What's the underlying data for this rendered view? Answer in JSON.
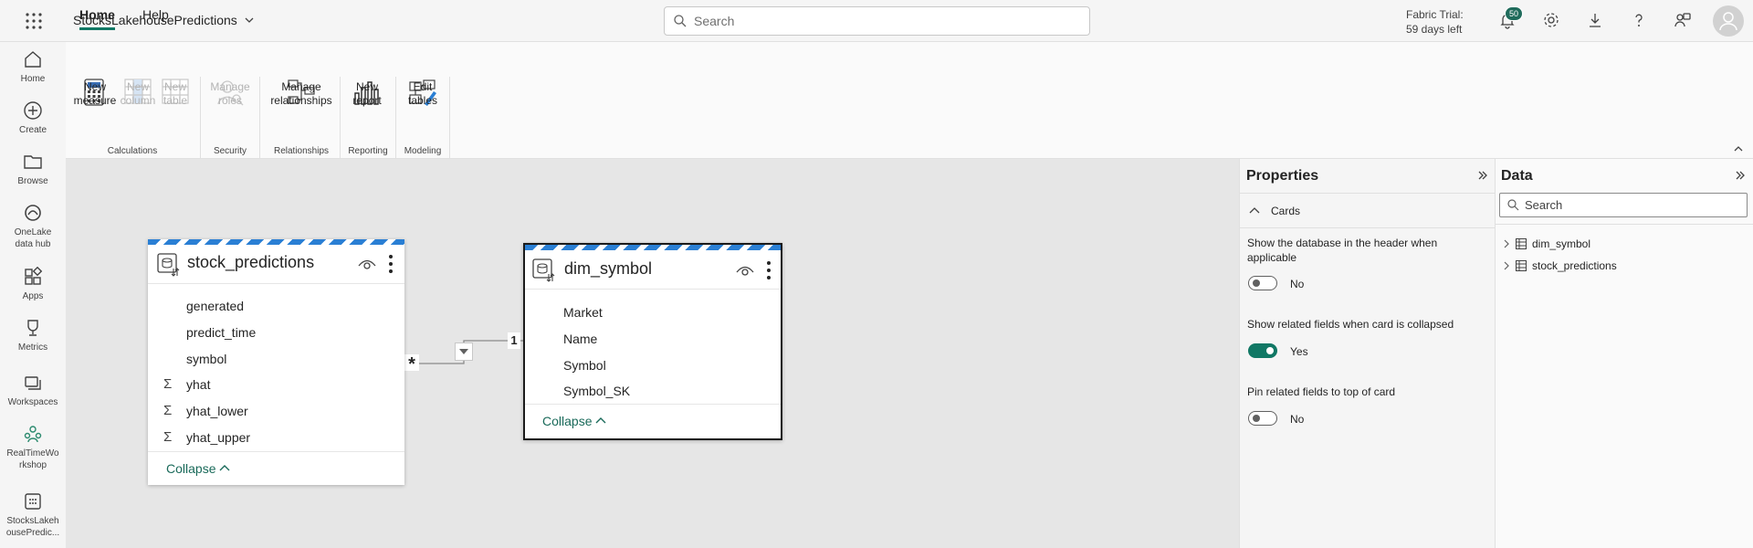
{
  "header": {
    "app_name": "StocksLakehousePredictions",
    "search_placeholder": "Search",
    "trial_line1": "Fabric Trial:",
    "trial_line2": "59 days left",
    "notifications_count": "50"
  },
  "rail": {
    "items": [
      {
        "label": "Home",
        "icon": "home-icon"
      },
      {
        "label": "Create",
        "icon": "create-icon"
      },
      {
        "label": "Browse",
        "icon": "browse-icon"
      },
      {
        "label_line1": "OneLake",
        "label_line2": "data hub",
        "icon": "onelake-icon"
      },
      {
        "label": "Apps",
        "icon": "apps-icon"
      },
      {
        "label": "Metrics",
        "icon": "metrics-icon"
      },
      {
        "label": "Workspaces",
        "icon": "workspaces-icon"
      },
      {
        "label_line1": "RealTimeWo",
        "label_line2": "rkshop",
        "icon": "workspace-icon"
      },
      {
        "label_line1": "StocksLakeh",
        "label_line2": "ousePredic...",
        "icon": "model-icon"
      }
    ]
  },
  "ribbon": {
    "tabs": [
      "Home",
      "Help"
    ],
    "buttons": {
      "new_measure": [
        "New",
        "measure"
      ],
      "new_column": [
        "New",
        "column"
      ],
      "new_table": [
        "New",
        "table"
      ],
      "manage_roles": [
        "Manage",
        "roles"
      ],
      "manage_relationships": [
        "Manage",
        "relationships"
      ],
      "new_report": [
        "New",
        "report"
      ],
      "edit_tables": [
        "Edit",
        "tables"
      ]
    },
    "groups": {
      "calculations": "Calculations",
      "security": "Security",
      "relationships": "Relationships",
      "reporting": "Reporting",
      "modeling": "Modeling"
    }
  },
  "canvas": {
    "stock_predictions": {
      "title": "stock_predictions",
      "fields": [
        {
          "name": "generated",
          "sigma": false
        },
        {
          "name": "predict_time",
          "sigma": false
        },
        {
          "name": "symbol",
          "sigma": false
        },
        {
          "name": "yhat",
          "sigma": true
        },
        {
          "name": "yhat_lower",
          "sigma": true
        },
        {
          "name": "yhat_upper",
          "sigma": true
        }
      ],
      "collapse": "Collapse"
    },
    "dim_symbol": {
      "title": "dim_symbol",
      "fields": [
        "Market",
        "Name",
        "Symbol",
        "Symbol_SK"
      ],
      "collapse": "Collapse"
    },
    "relationship": {
      "many": "*",
      "one": "1"
    }
  },
  "properties": {
    "title": "Properties",
    "section": "Cards",
    "opt1_label": "Show the database in the header when applicable",
    "opt1_value": "No",
    "opt1_on": false,
    "opt2_label": "Show related fields when card is collapsed",
    "opt2_value": "Yes",
    "opt2_on": true,
    "opt3_label": "Pin related fields to top of card",
    "opt3_value": "No",
    "opt3_on": false
  },
  "data_pane": {
    "title": "Data",
    "search_placeholder": "Search",
    "tables": [
      "dim_symbol",
      "stock_predictions"
    ]
  },
  "colors": {
    "accent": "#117865",
    "stripe": "#2a7fd4"
  }
}
